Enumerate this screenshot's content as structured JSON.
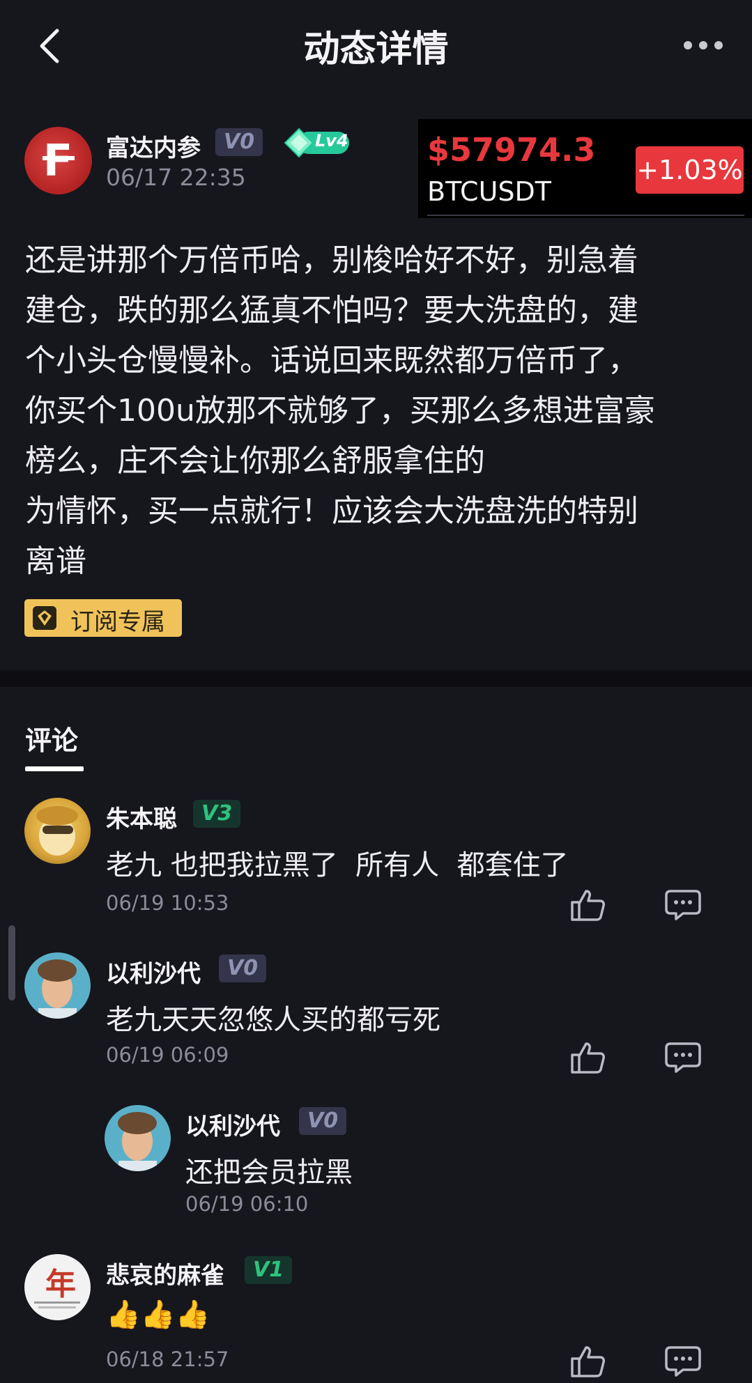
{
  "header": {
    "title": "动态详情",
    "back_icon": "chevron-left-icon",
    "more_icon": "more-dots-icon"
  },
  "post": {
    "author": "富达内参",
    "author_badge": "V0",
    "level_badge": "Lv4",
    "time": "06/17 22:35",
    "body": "还是讲那个万倍币哈，别梭哈好不好，别急着\n建仓，跌的那么猛真不怕吗？要大洗盘的，建\n个小头仓慢慢补。话说回来既然都万倍币了，\n你买个100u放那不就够了，买那么多想进富豪\n榜么，庄不会让你那么舒服拿住的\n为情怀，买一点就行！应该会大洗盘洗的特别\n离谱",
    "tag": "订阅专属"
  },
  "ticker": {
    "price": "$57974.3",
    "symbol": "BTCUSDT",
    "change": "+1.03%",
    "up_color": "#e8383d"
  },
  "comments_section": {
    "tab_label": "评论",
    "comments": [
      {
        "name": "朱本聪",
        "badge": "V3",
        "text": "老九 也把我拉黑了  所有人  都套住了",
        "time": "06/19 10:53"
      },
      {
        "name": "以利沙代",
        "badge": "V0",
        "text": "老九天天忽悠人买的都亏死",
        "time": "06/19 06:09"
      },
      {
        "name": "以利沙代",
        "badge": "V0",
        "text": "还把会员拉黑",
        "time": "06/19 06:10"
      },
      {
        "name": "悲哀的麻雀",
        "badge": "V1",
        "text": "👍👍👍",
        "time": "06/18 21:57"
      }
    ]
  }
}
